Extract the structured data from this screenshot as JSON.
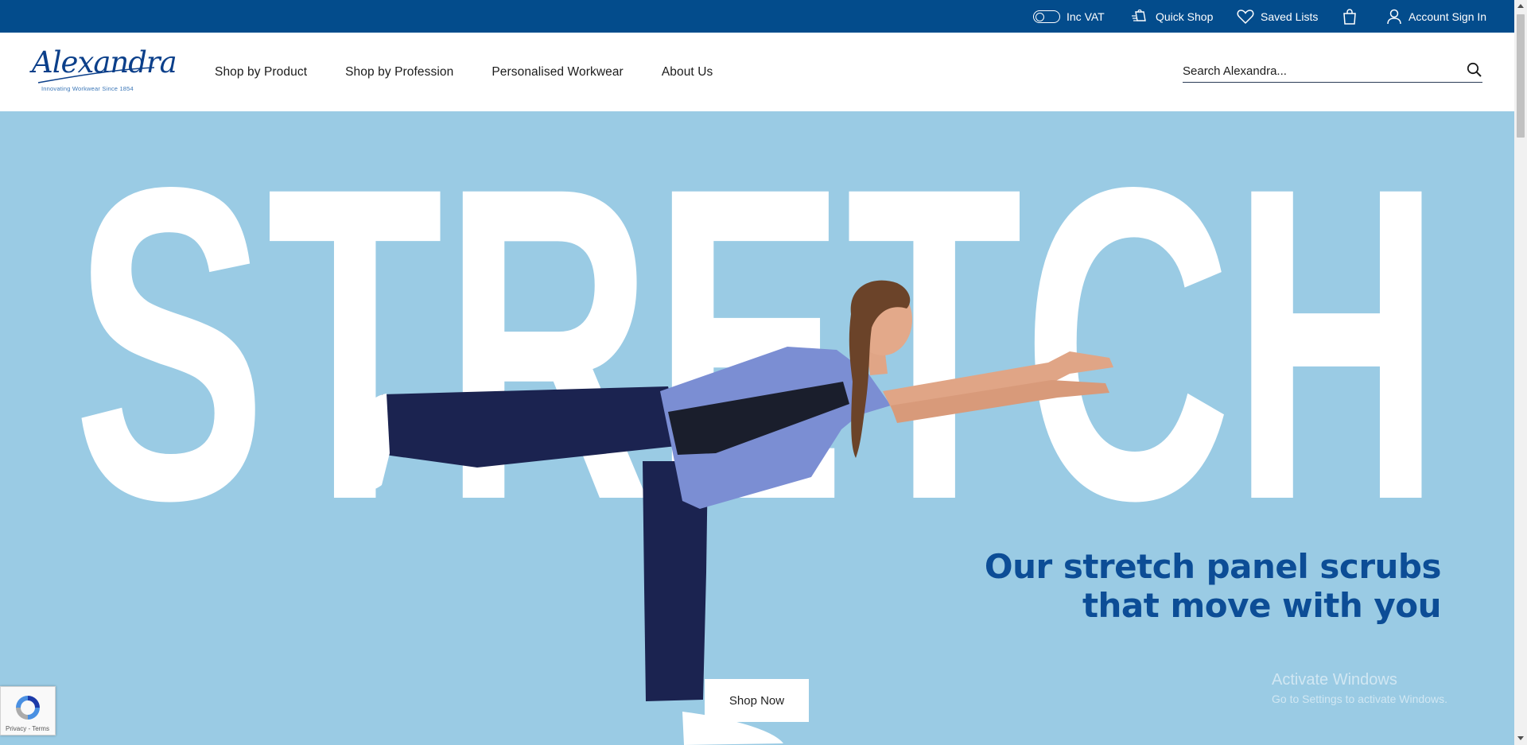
{
  "topbar": {
    "vat_label": "Inc VAT",
    "quick_shop_label": "Quick Shop",
    "saved_lists_label": "Saved Lists",
    "account_label": "Account Sign In",
    "background_color": "#034c8c"
  },
  "header": {
    "logo_text": "Alexandra",
    "logo_tagline": "Innovating Workwear Since 1854",
    "nav": [
      {
        "label": "Shop by Product"
      },
      {
        "label": "Shop by Profession"
      },
      {
        "label": "Personalised Workwear"
      },
      {
        "label": "About Us"
      }
    ],
    "search_placeholder": "Search Alexandra..."
  },
  "hero": {
    "big_word": "STRETCH",
    "headline_line1": "Our stretch panel scrubs",
    "headline_line2": "that move with you",
    "cta_label": "Shop Now",
    "background_color": "#9acbe4",
    "headline_color": "#0c4d96"
  },
  "overlay": {
    "watermark_line1": "Activate Windows",
    "watermark_line2": "Go to Settings to activate Windows.",
    "recaptcha_links": "Privacy - Terms"
  }
}
